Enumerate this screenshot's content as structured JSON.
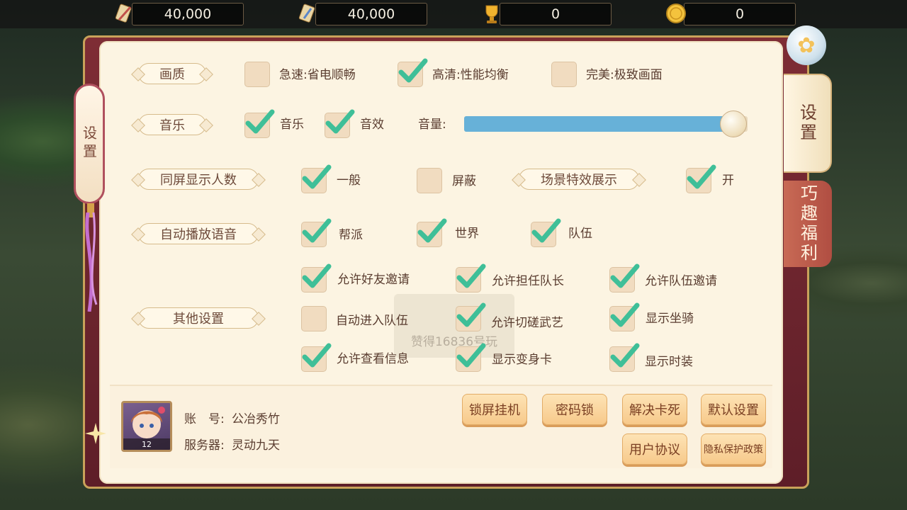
{
  "resources": [
    {
      "icon": "feather-scroll-icon",
      "value": "40,000"
    },
    {
      "icon": "diamond-scroll-icon",
      "value": "40,000"
    },
    {
      "icon": "trophy-icon",
      "value": "0"
    },
    {
      "icon": "gold-coin-icon",
      "value": "0"
    }
  ],
  "panel": {
    "left_tab": "设置",
    "side_tabs": {
      "active": "设置",
      "inactive": "巧趣福利"
    }
  },
  "quality": {
    "label": "画质",
    "options": [
      {
        "text": "急速:省电顺畅",
        "checked": false
      },
      {
        "text": "高清:性能均衡",
        "checked": true
      },
      {
        "text": "完美:极致画面",
        "checked": false
      }
    ]
  },
  "music": {
    "label": "音乐",
    "music": {
      "text": "音乐",
      "checked": true
    },
    "sfx": {
      "text": "音效",
      "checked": true
    },
    "volume_label": "音量:",
    "volume": 0.95
  },
  "display_count": {
    "label": "同屏显示人数",
    "normal": {
      "text": "一般",
      "checked": true
    },
    "hide": {
      "text": "屏蔽",
      "checked": false
    },
    "effects_label": "场景特效展示",
    "effects_on": {
      "text": "开",
      "checked": true
    }
  },
  "auto_voice": {
    "label": "自动播放语音",
    "options": [
      {
        "text": "帮派",
        "checked": true
      },
      {
        "text": "世界",
        "checked": true
      },
      {
        "text": "队伍",
        "checked": true
      }
    ]
  },
  "other": {
    "label": "其他设置",
    "options": [
      {
        "text": "允许好友邀请",
        "checked": true
      },
      {
        "text": "允许担任队长",
        "checked": true
      },
      {
        "text": "允许队伍邀请",
        "checked": true
      },
      {
        "text": "自动进入队伍",
        "checked": false
      },
      {
        "text": "允许切磋武艺",
        "checked": true
      },
      {
        "text": "显示坐骑",
        "checked": true
      },
      {
        "text": "允许查看信息",
        "checked": true
      },
      {
        "text": "显示变身卡",
        "checked": true
      },
      {
        "text": "显示时装",
        "checked": true
      }
    ]
  },
  "ghost_text": "赞得16836号玩",
  "account": {
    "account_label": "账　号:",
    "account_name": "公冶秀竹",
    "server_label": "服务器:",
    "server_name": "灵动九天",
    "level": "12"
  },
  "buttons": {
    "lock_screen": "锁屏挂机",
    "password_lock": "密码锁",
    "fix_stuck": "解决卡死",
    "default_settings": "默认设置",
    "user_agreement": "用户协议",
    "privacy_policy": "隐私保护政策"
  }
}
